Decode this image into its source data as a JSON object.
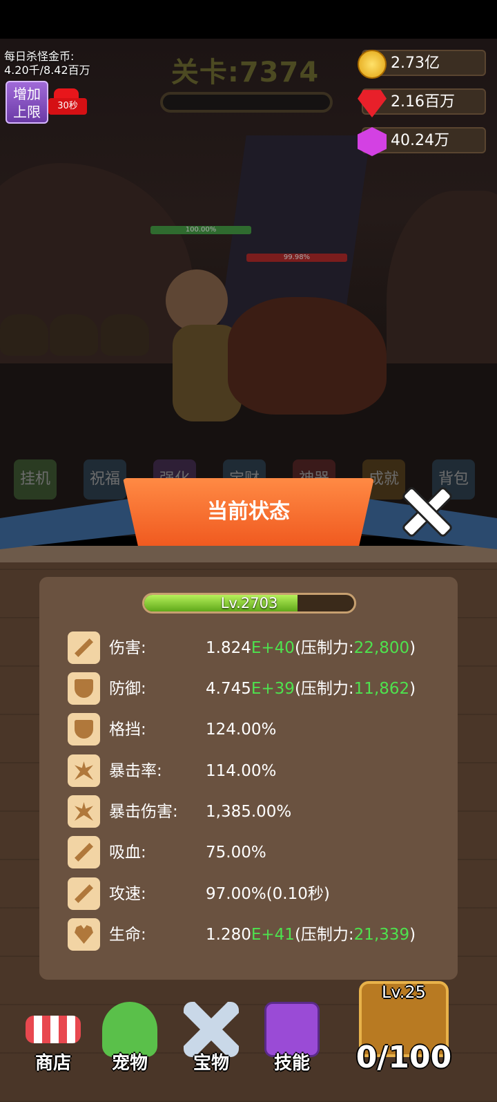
{
  "header": {
    "daily_gold_label": "每日杀怪金币:",
    "daily_gold_value": "4.20千/8.42百万",
    "add_limit_line1": "增加",
    "add_limit_line2": "上限",
    "video_timer": "30秒",
    "stage_title": "关卡:7374"
  },
  "resources": {
    "gold": "2.73亿",
    "ruby": "2.16百万",
    "gem": "40.24万"
  },
  "battle": {
    "hero_hp": "100.00%",
    "boss_hp": "99.98%"
  },
  "menu": {
    "items": [
      "挂机",
      "祝福",
      "强化",
      "宝财",
      "神器",
      "成就",
      "背包"
    ]
  },
  "dialog": {
    "title": "当前状态",
    "level_text": "Lv.2703",
    "level_progress": 0.73
  },
  "stats": [
    {
      "icon": "sword-icon",
      "label": "伤害:",
      "base": "1.824",
      "exp": "E+40",
      "pre": "(压制力:",
      "sup": "22,800",
      "post": ")"
    },
    {
      "icon": "shield-icon",
      "label": "防御:",
      "base": "4.745",
      "exp": "E+39",
      "pre": "(压制力:",
      "sup": "11,862",
      "post": ")"
    },
    {
      "icon": "block-shield-icon",
      "label": "格挡:",
      "value": "124.00%"
    },
    {
      "icon": "crit-burst-icon",
      "label": "暴击率:",
      "value": "114.00%"
    },
    {
      "icon": "crit-damage-icon",
      "label": "暴击伤害:",
      "value": "1,385.00%"
    },
    {
      "icon": "lifesteal-sword-icon",
      "label": "吸血:",
      "value": "75.00%"
    },
    {
      "icon": "attack-speed-icon",
      "label": "攻速:",
      "value": "97.00%(0.10秒)"
    },
    {
      "icon": "heart-plus-icon",
      "label": "生命:",
      "base": "1.280",
      "exp": "E+41",
      "pre": "(压制力:",
      "sup": "21,339",
      "post": ")"
    }
  ],
  "bottom_nav": {
    "shop": "商店",
    "pet": "宠物",
    "treasure": "宝物",
    "skill": "技能",
    "chest_level": "Lv.25",
    "chest_count": "0/100"
  }
}
